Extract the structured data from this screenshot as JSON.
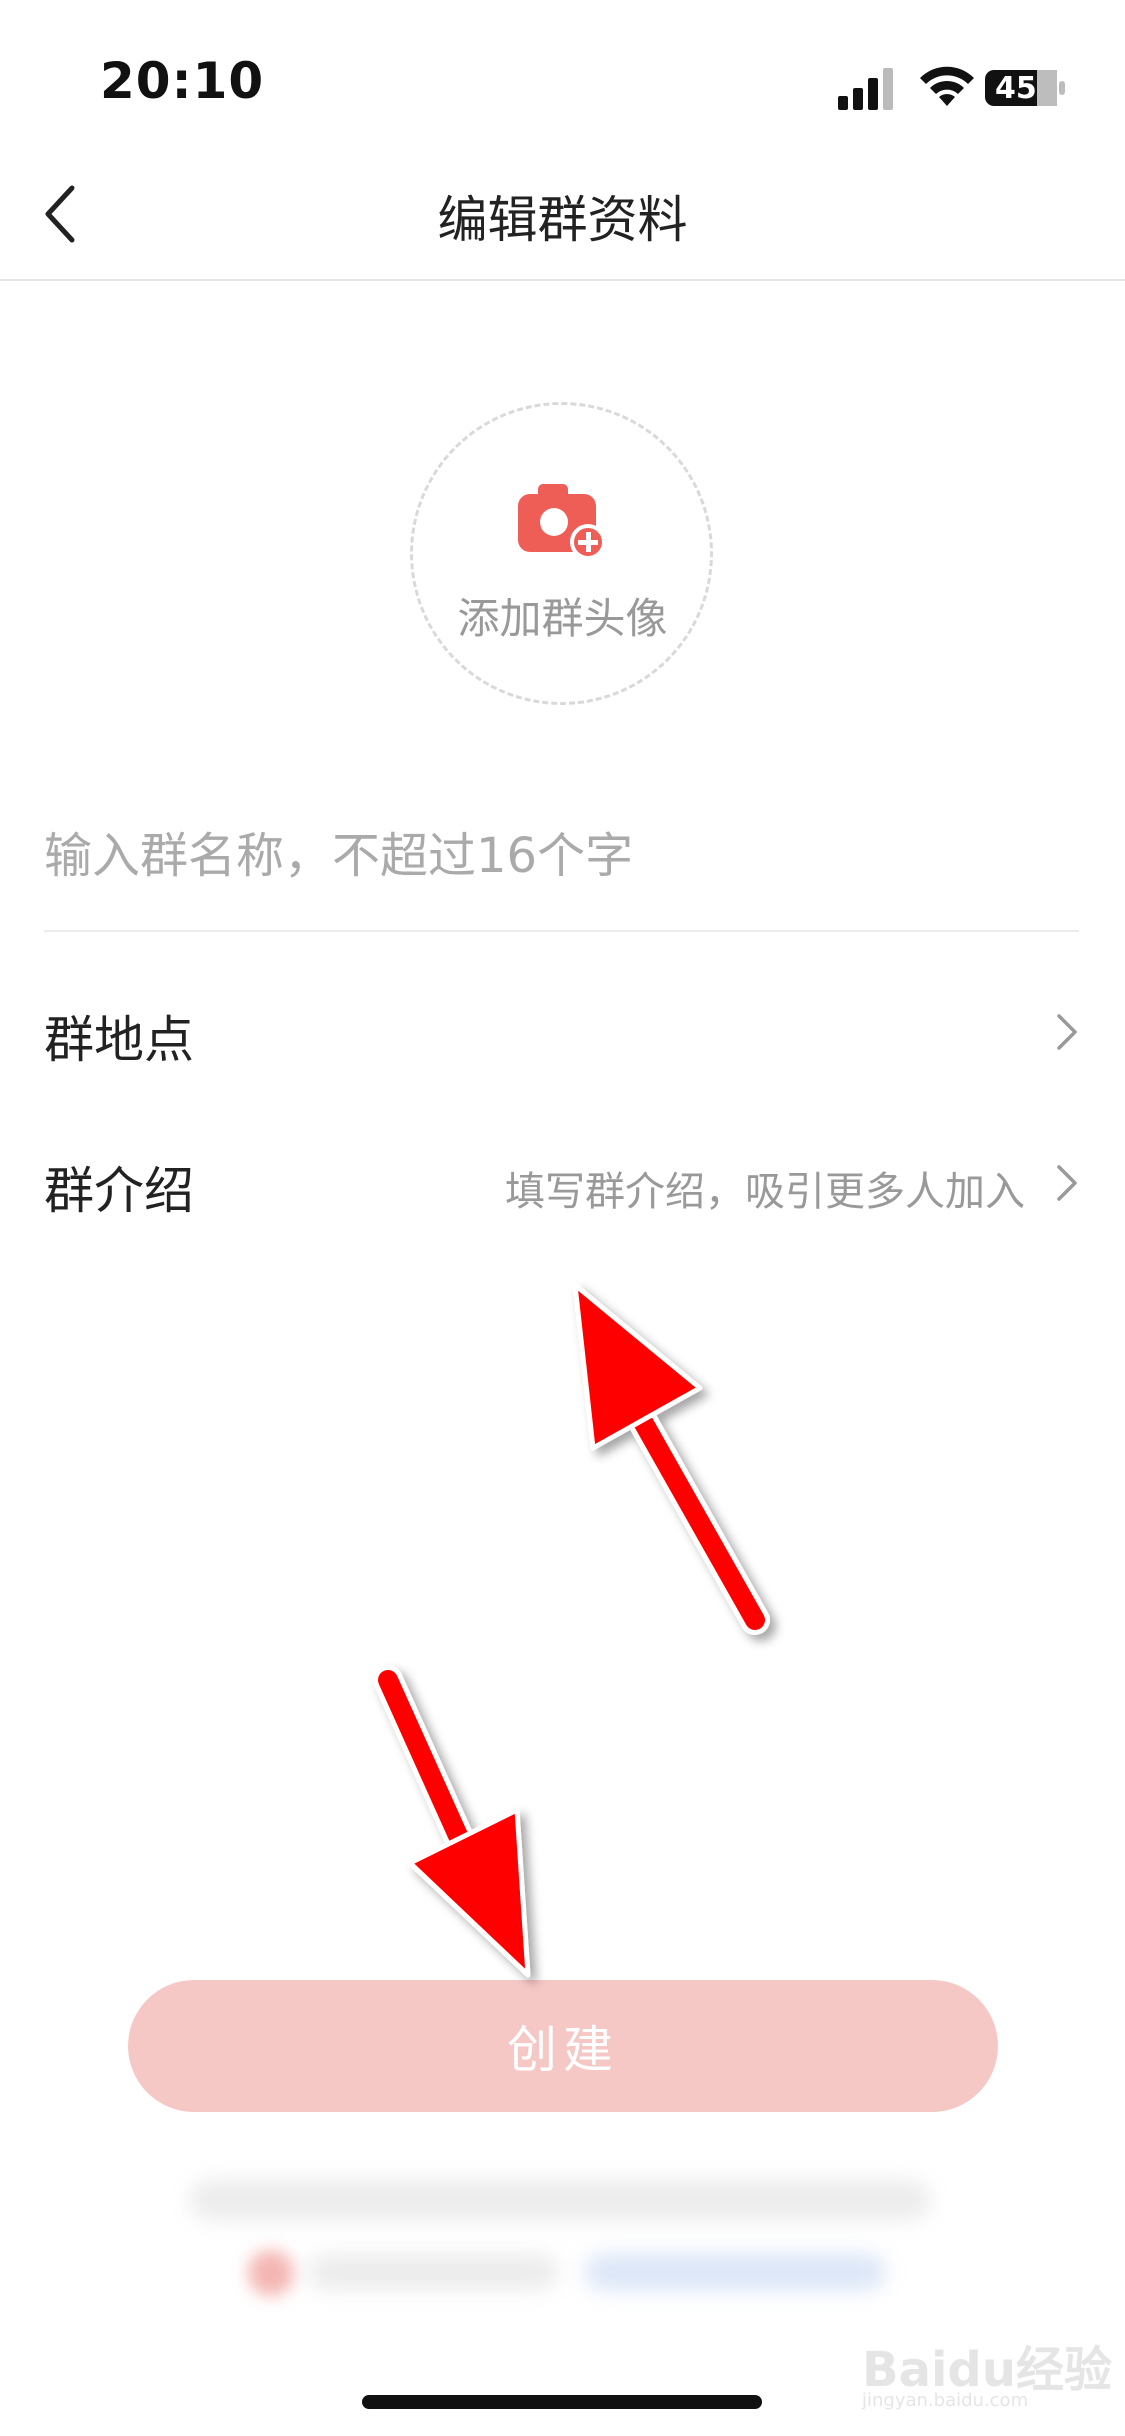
{
  "status_bar": {
    "time": "20:10",
    "battery": "45"
  },
  "nav": {
    "title": "编辑群资料"
  },
  "avatar": {
    "label": "添加群头像"
  },
  "group_name": {
    "placeholder": "输入群名称，不超过16个字",
    "value": ""
  },
  "rows": {
    "location": {
      "label": "群地点",
      "hint": ""
    },
    "intro": {
      "label": "群介绍",
      "hint": "填写群介绍，吸引更多人加入"
    }
  },
  "create_button": {
    "label": "创建"
  },
  "watermark": {
    "text": "Baidu经验",
    "sub": "jingyan.baidu.com"
  },
  "colors": {
    "accent": "#ee5e57",
    "button_disabled": "#f6c8c5",
    "annotation_arrow": "#ff0000"
  }
}
